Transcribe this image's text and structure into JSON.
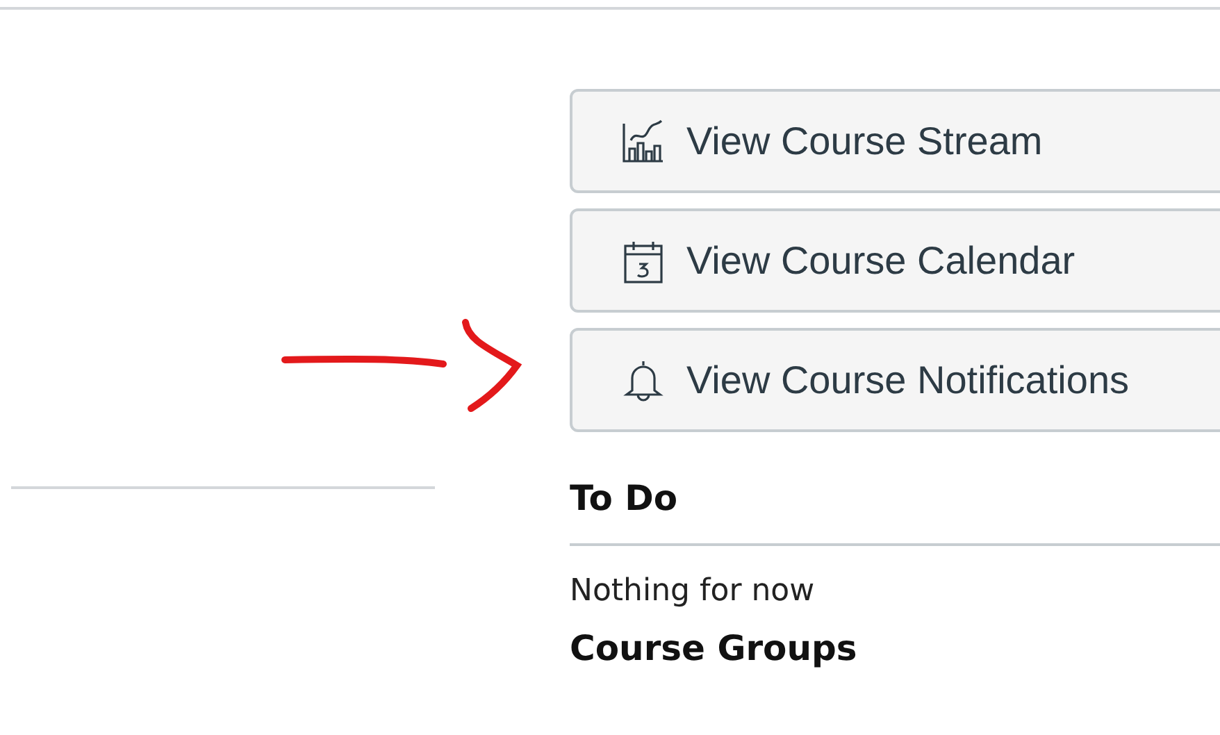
{
  "course_buttons": [
    {
      "label": "View Course Stream",
      "kind": "stream"
    },
    {
      "label": "View Course Calendar",
      "kind": "calendar"
    },
    {
      "label": "View Course Notifications",
      "kind": "notifications"
    }
  ],
  "annotation": {
    "kind": "arrow",
    "color": "#e3191b"
  },
  "todo": {
    "heading": "To Do",
    "empty_text": "Nothing for now"
  },
  "groups": {
    "heading": "Course Groups"
  }
}
